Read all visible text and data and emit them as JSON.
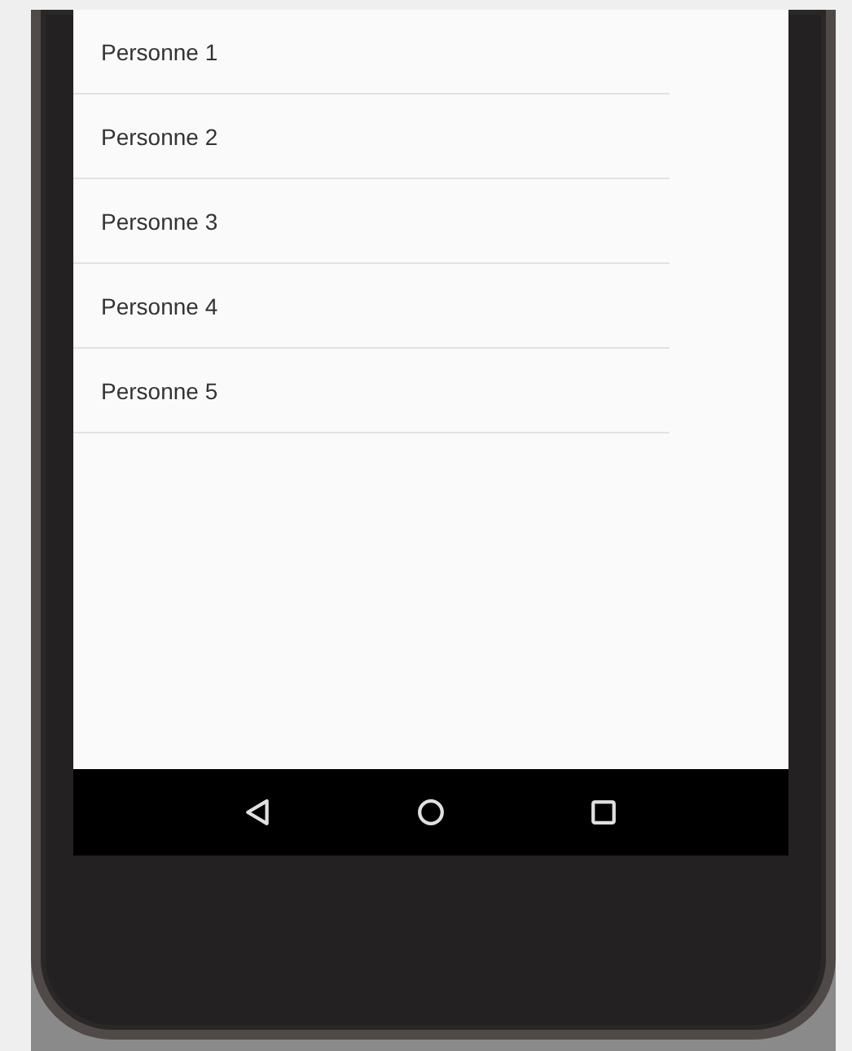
{
  "list": {
    "items": [
      {
        "label": "Personne 1"
      },
      {
        "label": "Personne 2"
      },
      {
        "label": "Personne 3"
      },
      {
        "label": "Personne 4"
      },
      {
        "label": "Personne 5"
      }
    ]
  },
  "navigation_bar": {
    "buttons": [
      {
        "kind": "back"
      },
      {
        "kind": "home"
      },
      {
        "kind": "recents"
      }
    ]
  }
}
